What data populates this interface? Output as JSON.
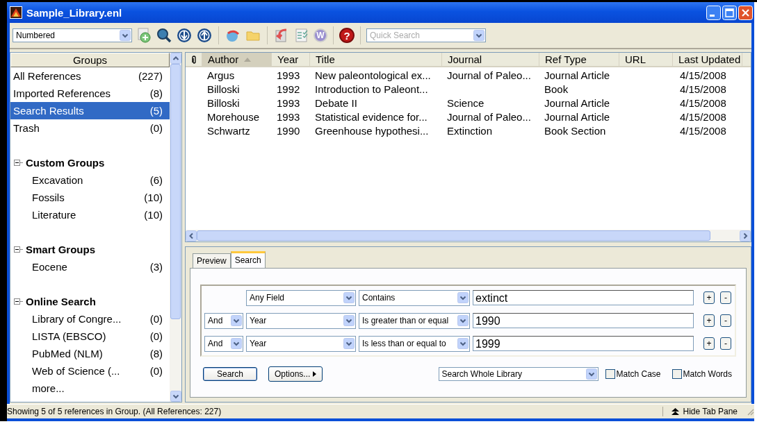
{
  "window": {
    "title": "Sample_Library.enl"
  },
  "toolbar": {
    "output_style": "Numbered",
    "word_glyph": "W",
    "help_glyph": "?",
    "quick_search": {
      "placeholder": "Quick Search"
    }
  },
  "groups": {
    "header": "Groups",
    "items": [
      {
        "label": "All References",
        "count": "(227)",
        "selected": false
      },
      {
        "label": "Imported References",
        "count": "(8)",
        "selected": false
      },
      {
        "label": "Search Results",
        "count": "(5)",
        "selected": true
      },
      {
        "label": "Trash",
        "count": "(0)",
        "selected": false
      }
    ],
    "sections": [
      {
        "title": "Custom Groups",
        "expanded": true,
        "children": [
          {
            "label": "Excavation",
            "count": "(6)",
            "selected": false
          },
          {
            "label": "Fossils",
            "count": "(10)",
            "selected": false
          },
          {
            "label": "Literature",
            "count": "(10)",
            "selected": false
          }
        ]
      },
      {
        "title": "Smart Groups",
        "expanded": true,
        "children": [
          {
            "label": "Eocene",
            "count": "(3)",
            "selected": false
          }
        ]
      },
      {
        "title": "Online Search",
        "expanded": true,
        "children": [
          {
            "label": "Library of Congre...",
            "count": "(0)",
            "selected": false
          },
          {
            "label": "LISTA (EBSCO)",
            "count": "(0)",
            "selected": false
          },
          {
            "label": "PubMed (NLM)",
            "count": "(8)",
            "selected": false
          },
          {
            "label": "Web of Science (...",
            "count": "(0)",
            "selected": false
          },
          {
            "label": "more...",
            "selected": false
          }
        ]
      }
    ]
  },
  "references": {
    "columns": [
      {
        "kind": "attachment",
        "sorted": false
      },
      {
        "label": "Author",
        "sorted": true
      },
      {
        "label": "Year",
        "sorted": false
      },
      {
        "label": "Title",
        "sorted": false
      },
      {
        "label": "Journal",
        "sorted": false
      },
      {
        "label": "Ref Type",
        "sorted": false
      },
      {
        "label": "URL",
        "sorted": false
      },
      {
        "label": "Last Updated",
        "sorted": false
      }
    ],
    "rows": [
      {
        "author": "Argus",
        "year": "1993",
        "title": "New paleontological ex...",
        "journal": "Journal of Paleo...",
        "ref_type": "Journal Article",
        "last_updated": "4/15/2008"
      },
      {
        "author": "Billoski",
        "year": "1992",
        "title": "Introduction to Paleont...",
        "ref_type": "Book",
        "last_updated": "4/15/2008"
      },
      {
        "author": "Billoski",
        "year": "1993",
        "title": "Debate II",
        "journal": "Science",
        "ref_type": "Journal Article",
        "last_updated": "4/15/2008"
      },
      {
        "author": "Morehouse",
        "year": "1993",
        "title": "Statistical evidence for...",
        "journal": "Journal of Paleo...",
        "ref_type": "Journal Article",
        "last_updated": "4/15/2008"
      },
      {
        "author": "Schwartz",
        "year": "1990",
        "title": "Greenhouse hypothesi...",
        "journal": "Extinction",
        "ref_type": "Book Section",
        "last_updated": "4/15/2008"
      }
    ]
  },
  "tabs": [
    {
      "label": "Preview",
      "selected": false
    },
    {
      "label": "Search",
      "selected": true
    }
  ],
  "search": {
    "criteria": [
      {
        "field": "Any Field",
        "operator": "Contains",
        "value": "extinct",
        "add": "+",
        "remove": "-"
      },
      {
        "connector": "And",
        "field": "Year",
        "operator": "Is greater than or equal",
        "value": "1990",
        "add": "+",
        "remove": "-"
      },
      {
        "connector": "And",
        "field": "Year",
        "operator": "Is less than or equal to",
        "value": "1999",
        "add": "+",
        "remove": "-"
      }
    ],
    "search_button": "Search",
    "options_button": "Options...",
    "scope": "Search Whole Library",
    "match_case": {
      "label": "Match Case",
      "checked": false
    },
    "match_words": {
      "label": "Match Words",
      "checked": false
    }
  },
  "status_bar": {
    "text": "Showing 5 of 5 references in Group. (All References: 227)",
    "hide_tab_pane": "Hide Tab Pane"
  }
}
